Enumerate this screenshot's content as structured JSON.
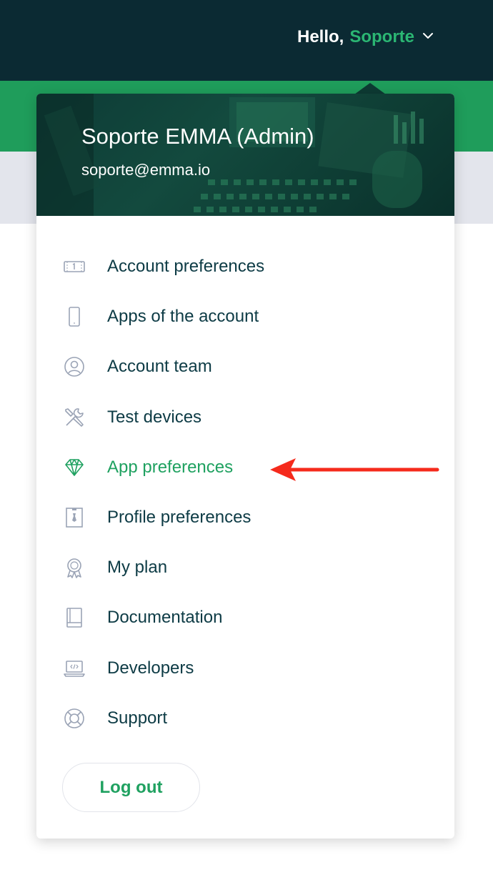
{
  "header": {
    "greeting": "Hello,",
    "user_name": "Soporte"
  },
  "profile": {
    "full_name": "Soporte EMMA (Admin)",
    "email": "soporte@emma.io"
  },
  "menu": {
    "items": [
      {
        "label": "Account preferences",
        "icon": "money-card-icon"
      },
      {
        "label": "Apps of the account",
        "icon": "mobile-phone-icon"
      },
      {
        "label": "Account team",
        "icon": "user-circle-icon"
      },
      {
        "label": "Test devices",
        "icon": "tools-icon"
      },
      {
        "label": "App preferences",
        "icon": "diamond-icon",
        "active": true
      },
      {
        "label": "Profile preferences",
        "icon": "id-badge-icon"
      },
      {
        "label": "My plan",
        "icon": "award-ribbon-icon"
      },
      {
        "label": "Documentation",
        "icon": "book-icon"
      },
      {
        "label": "Developers",
        "icon": "laptop-code-icon"
      },
      {
        "label": "Support",
        "icon": "lifebuoy-icon"
      }
    ],
    "logout_label": "Log out"
  },
  "colors": {
    "header_bg": "#0b2a33",
    "accent_green": "#1fa160",
    "menu_text": "#0d3b45",
    "icon_gray": "#9aa3b5",
    "annotation_arrow": "#f52a1c"
  }
}
